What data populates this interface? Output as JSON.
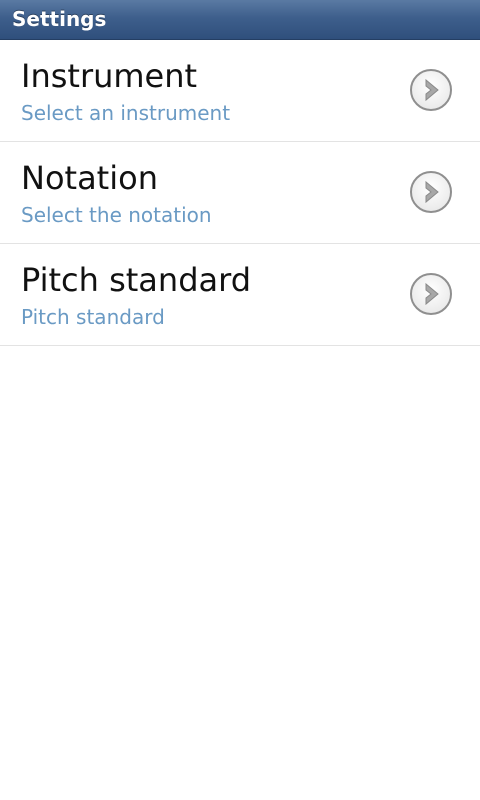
{
  "header": {
    "title": "Settings"
  },
  "settings": {
    "items": [
      {
        "title": "Instrument",
        "summary": "Select an instrument",
        "icon": "chevron-right-circle-icon"
      },
      {
        "title": "Notation",
        "summary": "Select the notation",
        "icon": "chevron-right-circle-icon"
      },
      {
        "title": "Pitch standard",
        "summary": "Pitch standard",
        "icon": "chevron-right-circle-icon"
      }
    ]
  },
  "colors": {
    "title_bar": "#3e5f8c",
    "summary_text": "#6a9ac4",
    "divider": "#e3e3e3",
    "background": "#ffffff"
  }
}
